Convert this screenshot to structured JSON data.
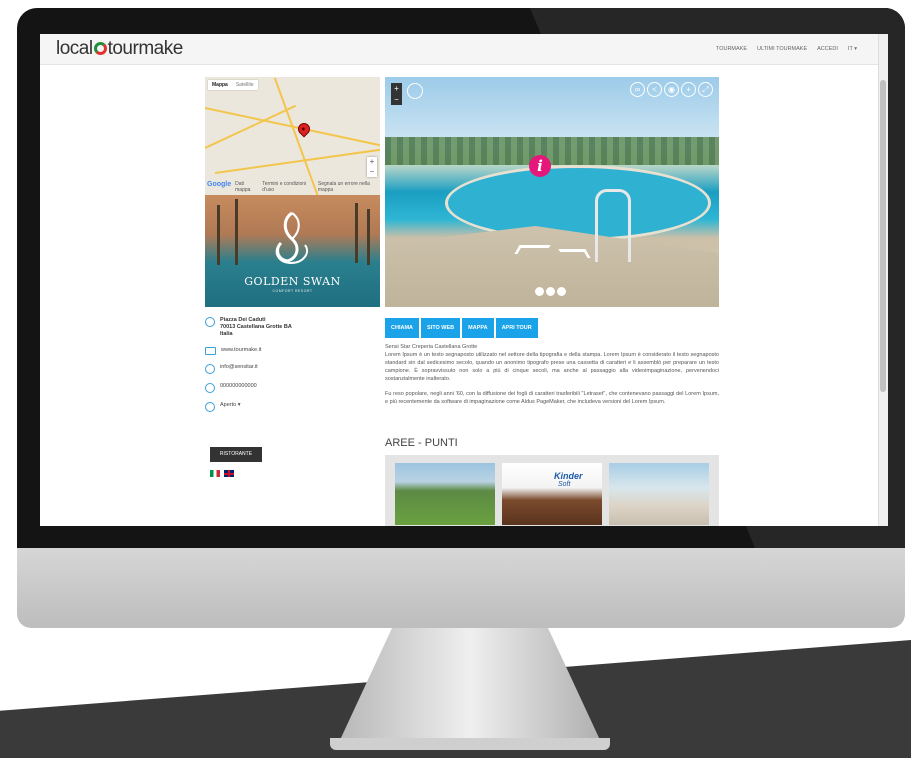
{
  "app": {
    "logo_left": "local",
    "logo_right": "tourmake"
  },
  "nav": {
    "items": [
      "TOURMAKE",
      "ULTIMI TOURMAKE",
      "ACCEDI",
      "IT ▾"
    ]
  },
  "map": {
    "tab_map": "Mappa",
    "tab_sat": "Satellite",
    "zoom_in": "+",
    "zoom_out": "−",
    "google": "Google",
    "footer_dati": "Dati mappa",
    "footer_terms": "Termini e condizioni d'uso",
    "footer_report": "Segnala un errore nella mappa"
  },
  "brand_image": {
    "title": "GOLDEN SWAN",
    "subtitle": "COMFORT RESORT"
  },
  "pano": {
    "zoom_in": "+",
    "zoom_out": "−",
    "info_glyph": "i",
    "icons": [
      "vr-icon",
      "share-icon",
      "location-icon",
      "add-icon",
      "fullscreen-icon"
    ]
  },
  "contact": {
    "address_line1": "Piazza Dei Caduti",
    "address_line2": "70013 Castellana Grotte BA",
    "address_line3": "Italia",
    "website": "www.tourmake.it",
    "email": "info@sensitar.it",
    "phone": "000000000000",
    "hours": "Aperto ▾"
  },
  "category_button": "RISTORANTE",
  "action_buttons": [
    "CHIAMA",
    "SITO WEB",
    "MAPPA",
    "APRI TOUR"
  ],
  "description": {
    "title": "Sensi Star Creperia Castellana Grotte",
    "para1": "Lorem Ipsum è un testo segnaposto utilizzato nel settore della tipografia e della stampa. Lorem Ipsum è considerato il testo segnaposto standard sin dal sedicesimo secolo, quando un anonimo tipografo prese una cassetta di caratteri e li assemblò per preparare un testo campione. È sopravvissuto non solo a più di cinque secoli, ma anche al passaggio alla videoimpaginazione, pervenendoci sostanzialmente inalterato.",
    "para2": "Fu reso popolare, negli anni '60, con la diffusione dei fogli di caratteri trasferibili \"Letraset\", che contenevano passaggi del Lorem Ipsum, e più recentemente da software di impaginazione come Aldus PageMaker, che includeva versioni del Lorem Ipsum."
  },
  "section_title": "AREE - PUNTI",
  "gallery": {
    "kinder_brand": "Kinder",
    "kinder_product": "Soft"
  },
  "colors": {
    "accent": "#1aa3e8",
    "hotspot": "#e5177a",
    "dark_button": "#333333"
  }
}
